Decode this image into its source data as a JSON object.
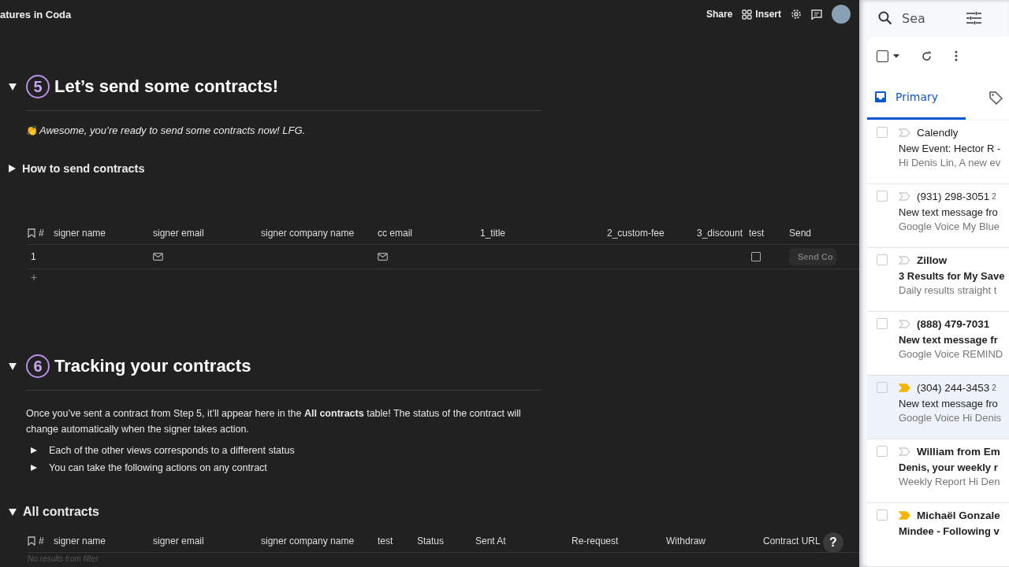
{
  "doc_title": "atures in Coda",
  "top_actions": {
    "share": "Share",
    "insert": "Insert"
  },
  "section5": {
    "number": "5",
    "title": "Let’s send some contracts!",
    "expanded": true,
    "note_emoji": "👏",
    "note": "Awesome, you’re ready to send some contracts now! LFG.",
    "toggle": {
      "label": "How to send contracts",
      "expanded": false
    }
  },
  "send_table": {
    "number_header": "#",
    "columns": [
      {
        "label": "signer name",
        "kind": "text"
      },
      {
        "label": "signer email",
        "kind": "email"
      },
      {
        "label": "signer company name",
        "kind": "text"
      },
      {
        "label": "cc email",
        "kind": "email"
      },
      {
        "label": "1_title",
        "kind": "text"
      },
      {
        "label": "2_custom-fee",
        "kind": "text"
      },
      {
        "label": "3_discount",
        "kind": "text"
      },
      {
        "label": "test",
        "kind": "checkbox"
      },
      {
        "label": "Send",
        "kind": "button"
      }
    ],
    "rows": [
      {
        "number": "1",
        "test_checked": false,
        "send_label": "Send Co"
      }
    ],
    "add_row": "+"
  },
  "section6": {
    "number": "6",
    "title": "Tracking your contracts",
    "expanded": true,
    "paragraph": "Once you’ve sent a contract from Step 5, it’ll appear here in the **All contracts** table! The status of the contract will change automatically when the signer takes action.",
    "toggles": [
      {
        "label": "Each of the other views corresponds to a different status",
        "expanded": false
      },
      {
        "label": "You can take the following actions on any contract",
        "expanded": false
      }
    ]
  },
  "all_contracts": {
    "title": "All contracts",
    "expanded": true,
    "number_header": "#",
    "columns": [
      "signer name",
      "signer email",
      "signer company name",
      "test",
      "Status",
      "Sent At",
      "Re-request",
      "Withdraw",
      "Contract URL"
    ],
    "empty_text": "No results from filter"
  },
  "help": "?",
  "mail": {
    "search_placeholder": "Sea",
    "select_all_checked": false,
    "tab": {
      "label": "Primary",
      "selected": true
    },
    "emails": [
      {
        "sender": "Calendly",
        "subject": "New Event: Hector R -",
        "snippet": "Hi Denis Lin, A new ev",
        "unread": false,
        "important": false,
        "selected": false
      },
      {
        "sender": "(931) 298-3051",
        "count": "2",
        "subject": "New text message fro",
        "snippet": "Google Voice My Blue",
        "unread": false,
        "important": false,
        "selected": false
      },
      {
        "sender": "Zillow",
        "subject": "3 Results for My Save",
        "snippet": "Daily results straight t",
        "unread": true,
        "important": false,
        "selected": false
      },
      {
        "sender": "(888) 479-7031",
        "subject": "New text message fr",
        "snippet": "Google Voice REMIND",
        "unread": true,
        "important": false,
        "selected": false
      },
      {
        "sender": "(304) 244-3453",
        "count": "2",
        "subject": "New text message fro",
        "snippet": "Google Voice Hi Denis",
        "unread": false,
        "important": true,
        "selected": true
      },
      {
        "sender": "William from Em",
        "subject": "Denis, your weekly r",
        "snippet": "Weekly Report Hi Den",
        "unread": true,
        "important": false,
        "selected": false
      },
      {
        "sender": "Michaël Gonzale",
        "subject": "Mindee - Following v",
        "unread": true,
        "important": true,
        "selected": false
      }
    ]
  }
}
